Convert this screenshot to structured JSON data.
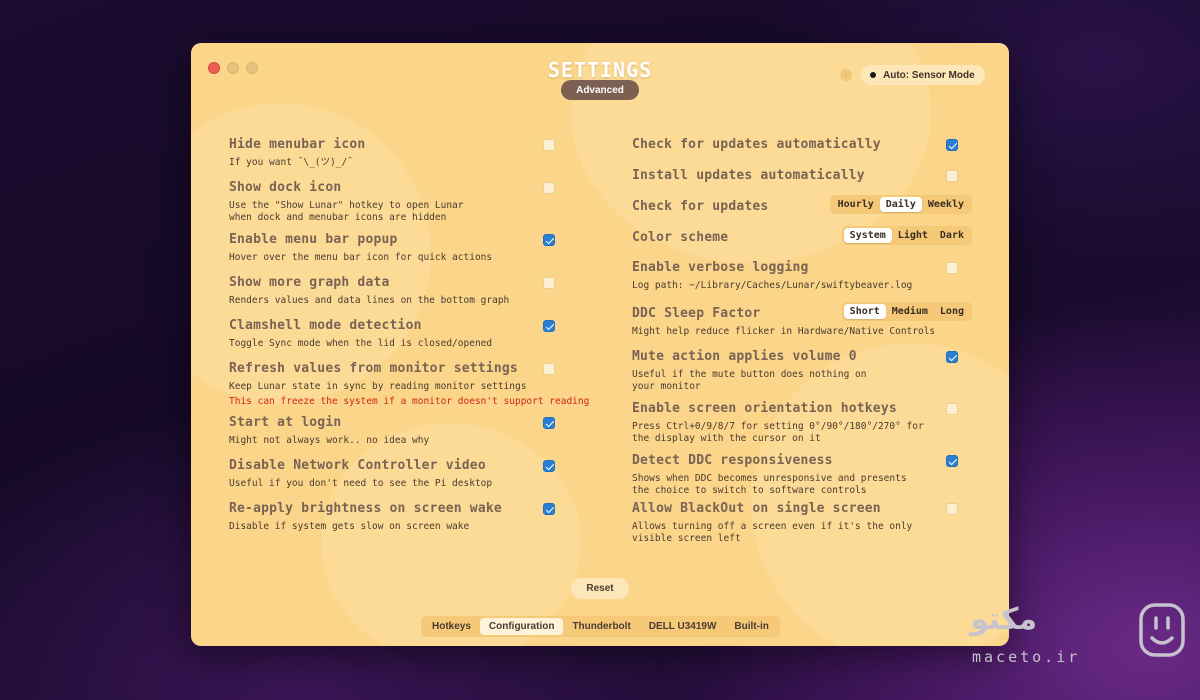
{
  "window": {
    "title": "SETTINGS",
    "mode": "Advanced",
    "info_symbol": "i",
    "sensor_mode": "Auto: Sensor Mode"
  },
  "left_settings": [
    {
      "title": "Hide menubar icon",
      "desc": "If you want ¯\\_(ツ)_/¯",
      "checked": false
    },
    {
      "title": "Show dock icon",
      "desc": "Use the \"Show Lunar\" hotkey to open Lunar\nwhen dock and menubar icons are hidden",
      "checked": false
    },
    {
      "title": "Enable menu bar popup",
      "desc": "Hover over the menu bar icon for quick actions",
      "checked": true
    },
    {
      "title": "Show more graph data",
      "desc": "Renders values and data lines on the bottom graph",
      "checked": false
    },
    {
      "title": "Clamshell mode detection",
      "desc": "Toggle Sync mode when the lid is closed/opened",
      "checked": true
    },
    {
      "title": "Refresh values from monitor settings",
      "desc": "Keep Lunar state in sync by reading monitor settings",
      "warning": "This can freeze the system if a monitor doesn't support reading",
      "checked": false
    },
    {
      "title": "Start at login",
      "desc": "Might not always work.. no idea why",
      "checked": true
    },
    {
      "title": "Disable Network Controller video",
      "desc": "Useful if you don't need to see the Pi desktop",
      "checked": true
    },
    {
      "title": "Re-apply brightness on screen wake",
      "desc": "Disable if system gets slow on screen wake",
      "checked": true
    }
  ],
  "right_settings": [
    {
      "title": "Check for updates automatically",
      "desc": "",
      "checked": true
    },
    {
      "title": "Install updates automatically",
      "desc": "",
      "checked": false
    },
    {
      "title": "Check for updates",
      "desc": "",
      "options": [
        "Hourly",
        "Daily",
        "Weekly"
      ],
      "selected": "Daily"
    },
    {
      "title": "Color scheme",
      "desc": "",
      "options": [
        "System",
        "Light",
        "Dark"
      ],
      "selected": "System"
    },
    {
      "title": "Enable verbose logging",
      "desc": "Log path: ~/Library/Caches/Lunar/swiftybeaver.log",
      "checked": false
    },
    {
      "title": "DDC Sleep Factor",
      "desc": "Might help reduce flicker in Hardware/Native Controls",
      "options": [
        "Short",
        "Medium",
        "Long"
      ],
      "selected": "Short"
    },
    {
      "title": "Mute action applies volume 0",
      "desc": "Useful if the mute button does nothing on\nyour monitor",
      "checked": true
    },
    {
      "title": "Enable screen orientation hotkeys",
      "desc": "Press Ctrl+0/9/8/7 for setting 0°/90°/180°/270° for\nthe display with the cursor on it",
      "checked": false
    },
    {
      "title": "Detect DDC responsiveness",
      "desc": "Shows when DDC becomes unresponsive and presents\nthe choice to switch to software controls",
      "checked": true
    },
    {
      "title": "Allow BlackOut on single screen",
      "desc": "Allows turning off a screen even if it's the only\nvisible screen left",
      "checked": false
    }
  ],
  "reset_label": "Reset",
  "tabs": [
    "Hotkeys",
    "Configuration",
    "Thunderbolt",
    "DELL U3419W",
    "Built-in"
  ],
  "selected_tab": "Configuration",
  "watermark": {
    "fa": "مکتو",
    "en": "maceto.ir"
  },
  "colors": {
    "panel": "#fbd589",
    "checkbox_on": "#2a7fd4",
    "warning": "#d0241a",
    "mode_pill": "#7c6152"
  }
}
